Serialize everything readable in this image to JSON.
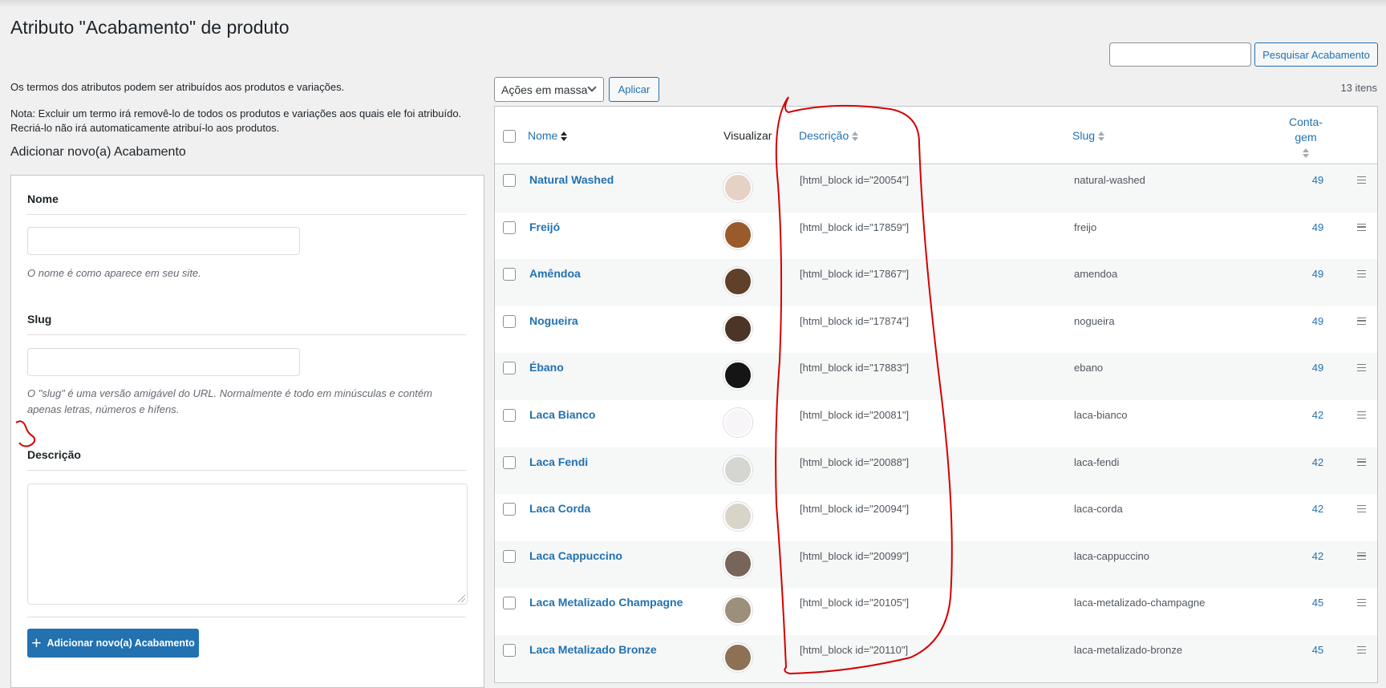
{
  "page": {
    "title": "Atributo \"Acabamento\" de produto"
  },
  "search": {
    "placeholder": "",
    "value": "",
    "button_label": "Pesquisar Acabamento"
  },
  "intro": {
    "line1": "Os termos dos atributos podem ser atribuídos aos produtos e variações.",
    "line2": "Nota: Excluir um termo irá removê-lo de todos os produtos e variações aos quais ele foi atribuído.",
    "line3": "Recriá-lo não irá automaticamente atribuí-lo aos produtos."
  },
  "form": {
    "title": "Adicionar novo(a) Acabamento",
    "name_label": "Nome",
    "name_value": "",
    "name_help": "O nome é como aparece em seu site.",
    "slug_label": "Slug",
    "slug_value": "",
    "slug_help": "O \"slug\" é uma versão amigável do URL. Normalmente é todo em minúsculas e contém apenas letras, números e hífens.",
    "description_label": "Descrição",
    "description_value": "",
    "submit_label": "Adicionar novo(a) Acabamento"
  },
  "toolbar": {
    "bulk_actions_selected": "Ações em massa",
    "apply_label": "Aplicar",
    "items_count": "13 itens"
  },
  "table": {
    "columns": {
      "name": "Nome",
      "preview": "Visualizar",
      "description": "Descrição",
      "slug": "Slug",
      "count_line1": "Conta-",
      "count_line2": "gem"
    },
    "rows": [
      {
        "name": "Natural Washed",
        "color": "#e6d2c5",
        "description": "[html_block id=\"20054\"]",
        "slug": "natural-washed",
        "count": "49"
      },
      {
        "name": "Freijó",
        "color": "#9a5a2c",
        "description": "[html_block id=\"17859\"]",
        "slug": "freijo",
        "count": "49"
      },
      {
        "name": "Amêndoa",
        "color": "#5e4128",
        "description": "[html_block id=\"17867\"]",
        "slug": "amendoa",
        "count": "49"
      },
      {
        "name": "Nogueira",
        "color": "#4b3526",
        "description": "[html_block id=\"17874\"]",
        "slug": "nogueira",
        "count": "49"
      },
      {
        "name": "Ébano",
        "color": "#151515",
        "description": "[html_block id=\"17883\"]",
        "slug": "ebano",
        "count": "49"
      },
      {
        "name": "Laca Bianco",
        "color": "#f8f5f8",
        "description": "[html_block id=\"20081\"]",
        "slug": "laca-bianco",
        "count": "42"
      },
      {
        "name": "Laca Fendi",
        "color": "#d5d6d2",
        "description": "[html_block id=\"20088\"]",
        "slug": "laca-fendi",
        "count": "42"
      },
      {
        "name": "Laca Corda",
        "color": "#d9d4c8",
        "description": "[html_block id=\"20094\"]",
        "slug": "laca-corda",
        "count": "42"
      },
      {
        "name": "Laca Cappuccino",
        "color": "#766558",
        "description": "[html_block id=\"20099\"]",
        "slug": "laca-cappuccino",
        "count": "42"
      },
      {
        "name": "Laca Metalizado Champagne",
        "color": "#9c8f7b",
        "description": "[html_block id=\"20105\"]",
        "slug": "laca-metalizado-champagne",
        "count": "45"
      },
      {
        "name": "Laca Metalizado Bronze",
        "color": "#8c7155",
        "description": "[html_block id=\"20110\"]",
        "slug": "laca-metalizado-bronze",
        "count": "45"
      }
    ]
  },
  "colors": {
    "accent": "#2271b1",
    "annotation": "#d40000"
  }
}
